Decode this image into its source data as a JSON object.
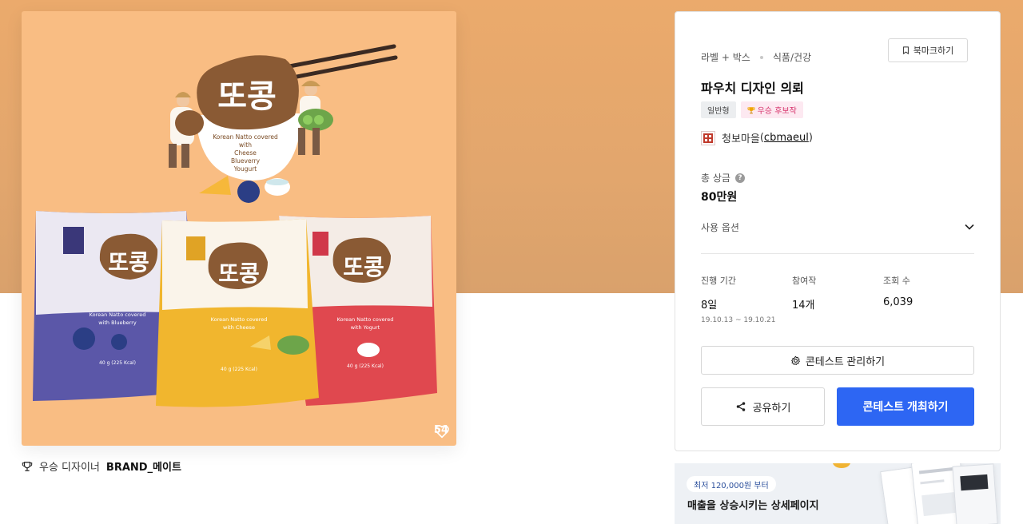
{
  "product": {
    "like_count": "54",
    "brand_title": "또콩",
    "hero_caption_lines": [
      "Korean Natto covered",
      "with",
      "Cheese",
      "Blueverry",
      "Yougurt"
    ],
    "packs": [
      {
        "brand": "또콩",
        "flavor_lines": [
          "Korean Natto covered",
          "with Blueberry"
        ],
        "weight": "40 g (225 Kcal)",
        "color": "#5b57a8"
      },
      {
        "brand": "또콩",
        "flavor_lines": [
          "Korean Natto covered",
          "with Cheese"
        ],
        "weight": "40 g (225 Kcal)",
        "color": "#f1b62e"
      },
      {
        "brand": "또콩",
        "flavor_lines": [
          "Korean Natto covered",
          "with Yogurt"
        ],
        "weight": "40 g (225 Kcal)",
        "color": "#e0484f"
      }
    ],
    "designer_prefix": "우승 디자이너",
    "designer_name": "BRAND_메이트"
  },
  "contest": {
    "category_main": "라벨 + 박스",
    "category_sub": "식품/건강",
    "bookmark_label": "북마크하기",
    "title": "파우치 디자인 의뢰",
    "tag_type": "일반형",
    "tag_winner": "우승 후보작",
    "owner_name": "청보마을",
    "owner_handle": "cbmaeul",
    "prize_label": "총 상금",
    "prize_value": "80만원",
    "options_label": "사용 옵션",
    "stats": {
      "period_label": "진행 기간",
      "period_value": "8일",
      "period_range": "19.10.13 ~ 19.10.21",
      "participants_label": "참여작",
      "participants_value": "14개",
      "views_label": "조회 수",
      "views_value": "6,039"
    },
    "manage_label": "콘테스트 관리하기",
    "share_label": "공유하기",
    "host_label": "콘테스트 개최하기"
  },
  "ad": {
    "pill": "최저 120,000원 부터",
    "title": "매출을 상승시키는 상세페이지"
  },
  "colors": {
    "accent": "#2d66f3",
    "band": "#e2a66d",
    "canvas": "#f9bd83"
  }
}
